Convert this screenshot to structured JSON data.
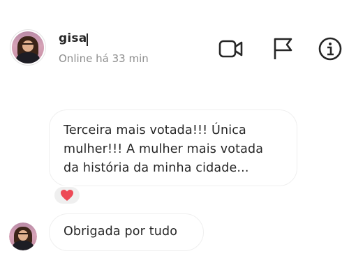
{
  "header": {
    "username": "gisa",
    "status": "Online há 33 min",
    "icons": [
      "video-call-icon",
      "flag-icon",
      "info-icon"
    ]
  },
  "messages": [
    {
      "text": "Terceira mais votada!!! Única\nmulher!!! A mulher mais votada\nda história da minha cidade...",
      "reaction": "heart"
    },
    {
      "text": "Obrigada por tudo"
    }
  ],
  "colors": {
    "text": "#262626",
    "secondary_text": "#8e8e8e",
    "bubble_border": "#efefef",
    "reaction_bg": "#efefef",
    "heart": "#ed4956"
  }
}
